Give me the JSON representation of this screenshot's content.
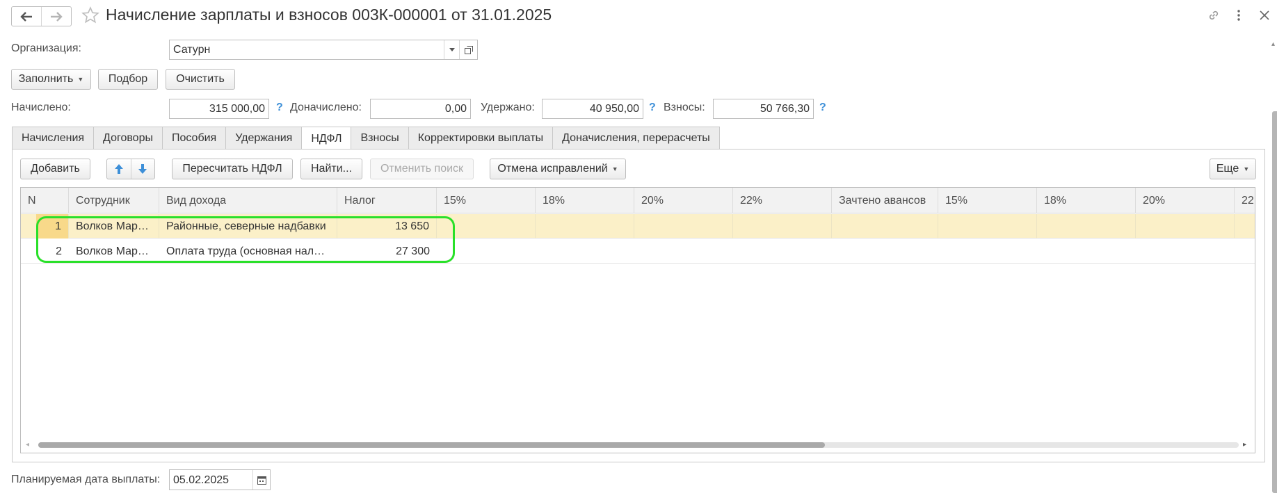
{
  "window": {
    "title": "Начисление зарплаты и взносов 003К-000001 от 31.01.2025",
    "icons": [
      "back-arrow-icon",
      "forward-arrow-icon",
      "star-icon",
      "link-icon",
      "more-vertical-icon",
      "close-icon"
    ]
  },
  "organization": {
    "label": "Организация:",
    "value": "Сатурн"
  },
  "top_buttons": {
    "fill": "Заполнить",
    "pick": "Подбор",
    "clear": "Очистить"
  },
  "totals": {
    "accrued_label": "Начислено:",
    "accrued_value": "315 000,00",
    "extra_label": "Доначислено:",
    "extra_value": "0,00",
    "withheld_label": "Удержано:",
    "withheld_value": "40 950,00",
    "contrib_label": "Взносы:",
    "contrib_value": "50 766,30",
    "help": "?"
  },
  "tabs": [
    {
      "label": "Начисления"
    },
    {
      "label": "Договоры"
    },
    {
      "label": "Пособия"
    },
    {
      "label": "Удержания"
    },
    {
      "label": "НДФЛ",
      "active": true
    },
    {
      "label": "Взносы"
    },
    {
      "label": "Корректировки выплаты"
    },
    {
      "label": "Доначисления, перерасчеты"
    }
  ],
  "toolbar": {
    "add": "Добавить",
    "recalc": "Пересчитать НДФЛ",
    "find": "Найти...",
    "cancel_search": "Отменить поиск",
    "undo_fixes": "Отмена исправлений",
    "more": "Еще"
  },
  "table": {
    "columns": [
      "N",
      "Сотрудник",
      "Вид дохода",
      "Налог",
      "15%",
      "18%",
      "20%",
      "22%",
      "Зачтено авансов",
      "15%",
      "18%",
      "20%",
      "22"
    ],
    "rows": [
      {
        "n": "1",
        "employee": "Волков Мар…",
        "income": "Районные, северные надбавки",
        "tax": "13 650",
        "selected": true
      },
      {
        "n": "2",
        "employee": "Волков Мар…",
        "income": "Оплата труда (основная нал…",
        "tax": "27 300",
        "selected": false
      }
    ]
  },
  "payment_date": {
    "label": "Планируемая дата выплаты:",
    "value": "05.02.2025"
  },
  "colors": {
    "selected_row": "#fbf0c8",
    "highlight_outline": "#29e029",
    "help_blue": "#3d8fd8"
  }
}
